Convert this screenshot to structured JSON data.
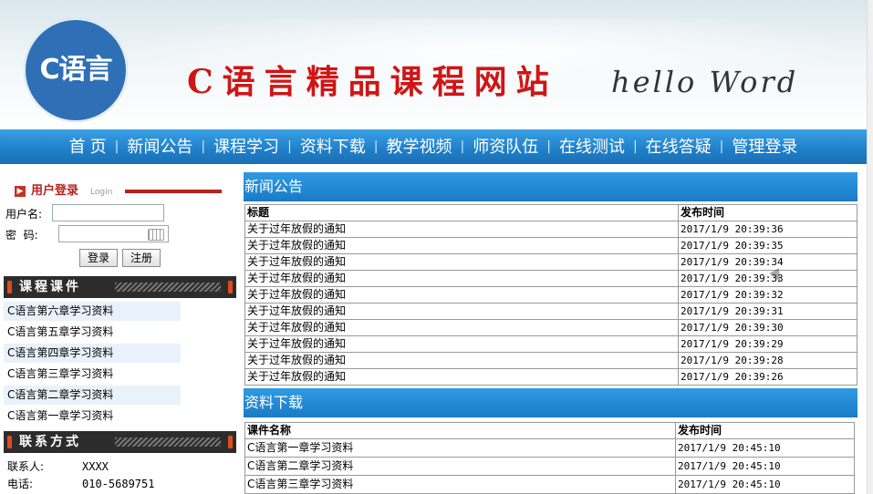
{
  "header": {
    "logo_text": "C语言",
    "site_title": "C语言精品课程网站",
    "subtitle": "hello Word",
    "colors": {
      "title": "#d01515",
      "logo": "#2f6fb6"
    }
  },
  "nav": {
    "items": [
      "首 页",
      "新闻公告",
      "课程学习",
      "资料下载",
      "教学视频",
      "师资队伍",
      "在线测试",
      "在线答疑",
      "管理登录"
    ],
    "separator": "|",
    "color": "#1f7fc9"
  },
  "login": {
    "title": "用户登录",
    "subtitle": "Login",
    "username_label": "用户名:",
    "username_value": "",
    "password_label": "密  码:",
    "password_value": "",
    "login_button": "登录",
    "register_button": "注册"
  },
  "courseware": {
    "title": "课程课件",
    "items": [
      "C语言第六章学习资料",
      "C语言第五章学习资料",
      "C语言第四章学习资料",
      "C语言第三章学习资料",
      "C语言第二章学习资料",
      "C语言第一章学习资料"
    ]
  },
  "contact": {
    "title": "联系方式",
    "rows": [
      {
        "label": "联系人:",
        "value": "XXXX"
      },
      {
        "label": "电话:",
        "value": "010-5689751"
      }
    ]
  },
  "news": {
    "title": "新闻公告",
    "columns": [
      "标题",
      "发布时间"
    ],
    "rows": [
      [
        "关于过年放假的通知",
        "2017/1/9 20:39:36"
      ],
      [
        "关于过年放假的通知",
        "2017/1/9 20:39:35"
      ],
      [
        "关于过年放假的通知",
        "2017/1/9 20:39:34"
      ],
      [
        "关于过年放假的通知",
        "2017/1/9 20:39:33"
      ],
      [
        "关于过年放假的通知",
        "2017/1/9 20:39:32"
      ],
      [
        "关于过年放假的通知",
        "2017/1/9 20:39:31"
      ],
      [
        "关于过年放假的通知",
        "2017/1/9 20:39:30"
      ],
      [
        "关于过年放假的通知",
        "2017/1/9 20:39:29"
      ],
      [
        "关于过年放假的通知",
        "2017/1/9 20:39:28"
      ],
      [
        "关于过年放假的通知",
        "2017/1/9 20:39:26"
      ]
    ]
  },
  "downloads": {
    "title": "资料下载",
    "columns": [
      "课件名称",
      "发布时间"
    ],
    "rows": [
      [
        "C语言第一章学习资料",
        "2017/1/9 20:45:10"
      ],
      [
        "C语言第二章学习资料",
        "2017/1/9 20:45:10"
      ],
      [
        "C语言第三章学习资料",
        "2017/1/9 20:45:10"
      ]
    ]
  }
}
